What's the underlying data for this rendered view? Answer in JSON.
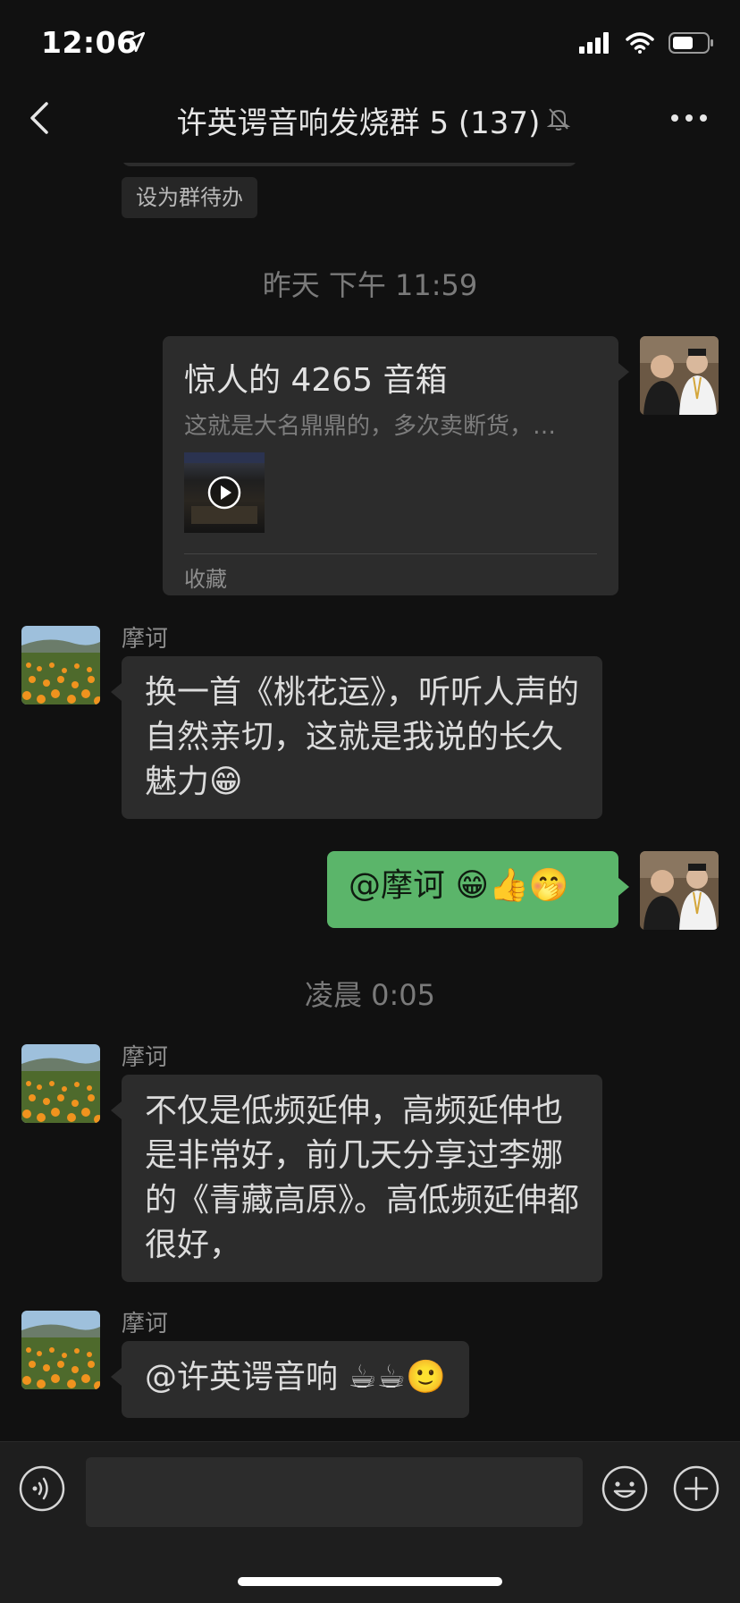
{
  "status_bar": {
    "time": "12:06"
  },
  "header": {
    "title": "许英谔音响发烧群 5 (137)"
  },
  "todo_button": "设为群待办",
  "timestamps": [
    "昨天 下午 11:59",
    "凌晨 0:05"
  ],
  "card_message": {
    "title": "惊人的 4265 音箱",
    "description": "这就是大名鼎鼎的，多次卖断货，…",
    "source": "收藏"
  },
  "messages": [
    {
      "sender": "摩诃",
      "text": "换一首《桃花运》，听听人声的自然亲切，这就是我说的长久魅力😁"
    },
    {
      "text": "@摩诃 😁👍🤭"
    },
    {
      "sender": "摩诃",
      "text": "不仅是低频延伸，高频延伸也是非常好，前几天分享过李娜的《青藏高原》。高低频延伸都很好，"
    },
    {
      "sender": "摩诃",
      "text": "@许英谔音响 ☕☕🙂"
    }
  ],
  "input": {
    "placeholder": ""
  },
  "colors": {
    "background": "#111111",
    "bubble": "#2c2c2c",
    "sent_bubble": "#5bb56a",
    "accent": "#5bb56a"
  },
  "icons": [
    "location-arrow-icon",
    "cellular-signal-icon",
    "wifi-icon",
    "battery-icon",
    "back-chevron-icon",
    "mute-bell-icon",
    "more-dots-icon",
    "play-icon",
    "voice-icon",
    "emoji-icon",
    "plus-icon"
  ]
}
